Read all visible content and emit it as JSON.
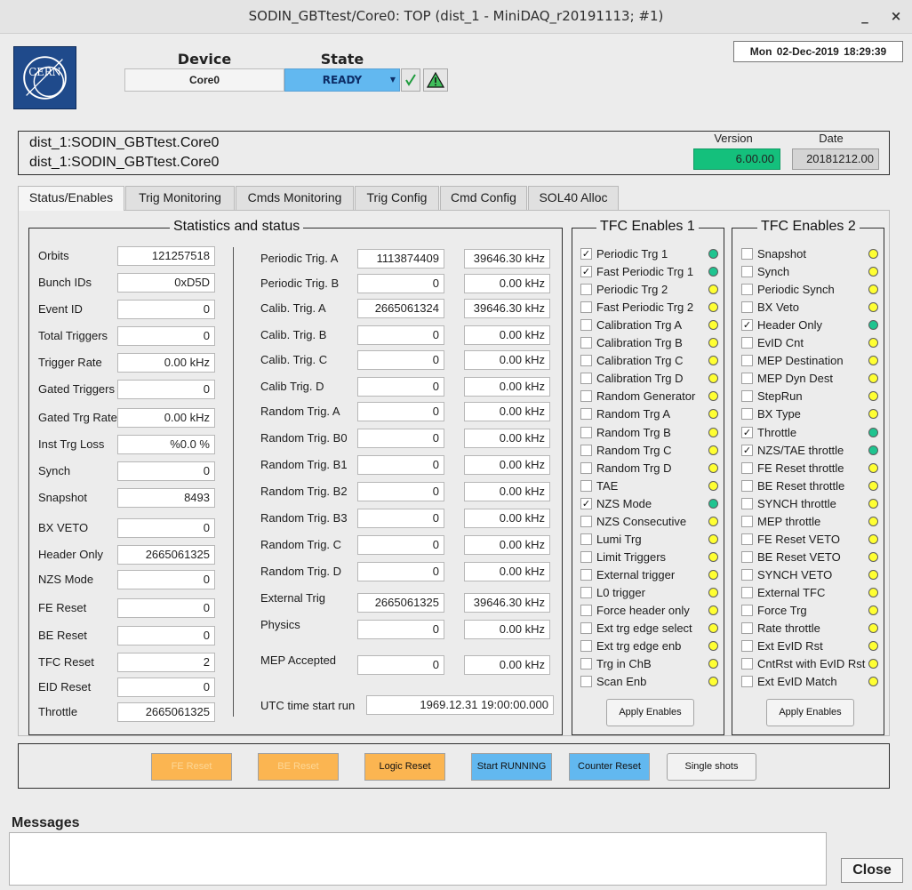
{
  "window": {
    "title": "SODIN_GBTtest/Core0: TOP (dist_1 - MiniDAQ_r20191113; #1)",
    "minimize": "_",
    "close": "×"
  },
  "header": {
    "device_label": "Device",
    "device_value": "Core0",
    "state_label": "State",
    "state_value": "READY",
    "date": "Mon  02-Dec-2019    18:29:39",
    "logo_text": "CERN"
  },
  "id_panel": {
    "line1": "dist_1:SODIN_GBTtest.Core0",
    "line2": "dist_1:SODIN_GBTtest.Core0",
    "version_label": "Version",
    "version_value": "6.00.00",
    "date_label": "Date",
    "date_value": "20181212.00"
  },
  "tabs": [
    {
      "label": "Status/Enables",
      "active": true
    },
    {
      "label": "Trig Monitoring",
      "active": false
    },
    {
      "label": "Cmds Monitoring",
      "active": false
    },
    {
      "label": "Trig Config",
      "active": false
    },
    {
      "label": "Cmd Config",
      "active": false
    },
    {
      "label": "SOL40 Alloc",
      "active": false
    }
  ],
  "stats": {
    "title": "Statistics and status",
    "left": [
      {
        "label": "Orbits",
        "value": "121257518"
      },
      {
        "label": "Bunch IDs",
        "value": "0xD5D"
      },
      {
        "label": "Event ID",
        "value": "0"
      },
      {
        "label": "Total Triggers",
        "value": "0"
      },
      {
        "label": "Trigger Rate",
        "value": "0.00 kHz"
      },
      {
        "label": "Gated Triggers",
        "value": "0"
      },
      {
        "label": "Gated Trg Rate",
        "value": "0.00 kHz"
      },
      {
        "label": "Inst Trg Loss",
        "value": "%0.0 %"
      },
      {
        "label": "Synch",
        "value": "0"
      },
      {
        "label": "Snapshot",
        "value": "8493"
      },
      {
        "label": "BX VETO",
        "value": "0"
      },
      {
        "label": "Header Only",
        "value": "2665061325"
      },
      {
        "label": "NZS Mode",
        "value": "0"
      },
      {
        "label": "FE Reset",
        "value": "0"
      },
      {
        "label": "BE Reset",
        "value": "0"
      },
      {
        "label": "TFC Reset",
        "value": "2"
      },
      {
        "label": "EID Reset",
        "value": "0"
      },
      {
        "label": "Throttle",
        "value": "2665061325"
      }
    ],
    "right": [
      {
        "label": "Periodic Trig. A",
        "count": "1113874409",
        "rate": "39646.30 kHz"
      },
      {
        "label": "Periodic Trig. B",
        "count": "0",
        "rate": "0.00 kHz"
      },
      {
        "label": "Calib. Trig. A",
        "count": "2665061324",
        "rate": "39646.30 kHz"
      },
      {
        "label": "Calib. Trig. B",
        "count": "0",
        "rate": "0.00 kHz"
      },
      {
        "label": "Calib. Trig. C",
        "count": "0",
        "rate": "0.00 kHz"
      },
      {
        "label": "Calib  Trig. D",
        "count": "0",
        "rate": "0.00 kHz"
      },
      {
        "label": "Random Trig. A",
        "count": "0",
        "rate": "0.00 kHz"
      },
      {
        "label": "Random Trig. B0",
        "count": "0",
        "rate": "0.00 kHz"
      },
      {
        "label": "Random Trig. B1",
        "count": "0",
        "rate": "0.00 kHz"
      },
      {
        "label": "Random Trig. B2",
        "count": "0",
        "rate": "0.00 kHz"
      },
      {
        "label": "Random Trig. B3",
        "count": "0",
        "rate": "0.00 kHz"
      },
      {
        "label": "Random Trig. C",
        "count": "0",
        "rate": "0.00 kHz"
      },
      {
        "label": "Random Trig. D",
        "count": "0",
        "rate": "0.00 kHz"
      },
      {
        "label": "External Trig",
        "count": "2665061325",
        "rate": "39646.30 kHz"
      },
      {
        "label": "Physics",
        "count": "0",
        "rate": "0.00 kHz"
      },
      {
        "label": "MEP Accepted",
        "count": "0",
        "rate": "0.00 kHz"
      }
    ],
    "utc_label": "UTC time start run",
    "utc_value": "1969.12.31 19:00:00.000"
  },
  "tfc1": {
    "title": "TFC Enables 1",
    "apply_label": "Apply Enables",
    "items": [
      {
        "label": "Periodic Trg 1",
        "checked": true,
        "led": "g"
      },
      {
        "label": "Fast Periodic Trg 1",
        "checked": true,
        "led": "g"
      },
      {
        "label": "Periodic Trg 2",
        "checked": false,
        "led": "y"
      },
      {
        "label": "Fast Periodic Trg 2",
        "checked": false,
        "led": "y"
      },
      {
        "label": "Calibration Trg A",
        "checked": false,
        "led": "y"
      },
      {
        "label": "Calibration Trg B",
        "checked": false,
        "led": "y"
      },
      {
        "label": "Calibration Trg C",
        "checked": false,
        "led": "y"
      },
      {
        "label": "Calibration Trg D",
        "checked": false,
        "led": "y"
      },
      {
        "label": "Random Generator",
        "checked": false,
        "led": "y"
      },
      {
        "label": "Random Trg A",
        "checked": false,
        "led": "y"
      },
      {
        "label": "Random Trg B",
        "checked": false,
        "led": "y"
      },
      {
        "label": "Random Trg C",
        "checked": false,
        "led": "y"
      },
      {
        "label": "Random Trg D",
        "checked": false,
        "led": "y"
      },
      {
        "label": "TAE",
        "checked": false,
        "led": "y"
      },
      {
        "label": "NZS Mode",
        "checked": true,
        "led": "g"
      },
      {
        "label": "NZS Consecutive",
        "checked": false,
        "led": "y"
      },
      {
        "label": "Lumi Trg",
        "checked": false,
        "led": "y"
      },
      {
        "label": "Limit Triggers",
        "checked": false,
        "led": "y"
      },
      {
        "label": "External trigger",
        "checked": false,
        "led": "y"
      },
      {
        "label": "L0 trigger",
        "checked": false,
        "led": "y"
      },
      {
        "label": "Force header only",
        "checked": false,
        "led": "y"
      },
      {
        "label": "Ext trg edge select",
        "checked": false,
        "led": "y"
      },
      {
        "label": "Ext trg edge enb",
        "checked": false,
        "led": "y"
      },
      {
        "label": "Trg in ChB",
        "checked": false,
        "led": "y"
      },
      {
        "label": "Scan Enb",
        "checked": false,
        "led": "y"
      }
    ]
  },
  "tfc2": {
    "title": "TFC Enables 2",
    "apply_label": "Apply Enables",
    "items": [
      {
        "label": "Snapshot",
        "checked": false,
        "led": "y"
      },
      {
        "label": "Synch",
        "checked": false,
        "led": "y"
      },
      {
        "label": "Periodic Synch",
        "checked": false,
        "led": "y"
      },
      {
        "label": "BX Veto",
        "checked": false,
        "led": "y"
      },
      {
        "label": "Header Only",
        "checked": true,
        "led": "g"
      },
      {
        "label": "EvID Cnt",
        "checked": false,
        "led": "y"
      },
      {
        "label": "MEP Destination",
        "checked": false,
        "led": "y"
      },
      {
        "label": "MEP Dyn Dest",
        "checked": false,
        "led": "y"
      },
      {
        "label": "StepRun",
        "checked": false,
        "led": "y"
      },
      {
        "label": "BX Type",
        "checked": false,
        "led": "y"
      },
      {
        "label": "Throttle",
        "checked": true,
        "led": "g"
      },
      {
        "label": "NZS/TAE throttle",
        "checked": true,
        "led": "g"
      },
      {
        "label": "FE Reset throttle",
        "checked": false,
        "led": "y"
      },
      {
        "label": "BE Reset throttle",
        "checked": false,
        "led": "y"
      },
      {
        "label": "SYNCH throttle",
        "checked": false,
        "led": "y"
      },
      {
        "label": "MEP throttle",
        "checked": false,
        "led": "y"
      },
      {
        "label": "FE Reset VETO",
        "checked": false,
        "led": "y"
      },
      {
        "label": "BE Reset VETO",
        "checked": false,
        "led": "y"
      },
      {
        "label": "SYNCH VETO",
        "checked": false,
        "led": "y"
      },
      {
        "label": "External TFC",
        "checked": false,
        "led": "y"
      },
      {
        "label": "Force Trg",
        "checked": false,
        "led": "y"
      },
      {
        "label": "Rate throttle",
        "checked": false,
        "led": "y"
      },
      {
        "label": "Ext EvID Rst",
        "checked": false,
        "led": "y"
      },
      {
        "label": "CntRst with EvID Rst",
        "checked": false,
        "led": "y"
      },
      {
        "label": "Ext EvID Match",
        "checked": false,
        "led": "y"
      }
    ]
  },
  "commands": {
    "fe_reset": "FE Reset",
    "be_reset": "BE Reset",
    "logic_reset": "Logic Reset",
    "start_running": "Start RUNNING",
    "counter_reset": "Counter Reset",
    "single_shots": "Single shots"
  },
  "messages": {
    "title": "Messages",
    "close": "Close"
  },
  "colors": {
    "ready_blue": "#62b8f0",
    "version_green": "#14c07c",
    "led_yellow": "#ffff33",
    "led_green": "#1fc490",
    "command_orange": "#fbb551"
  }
}
